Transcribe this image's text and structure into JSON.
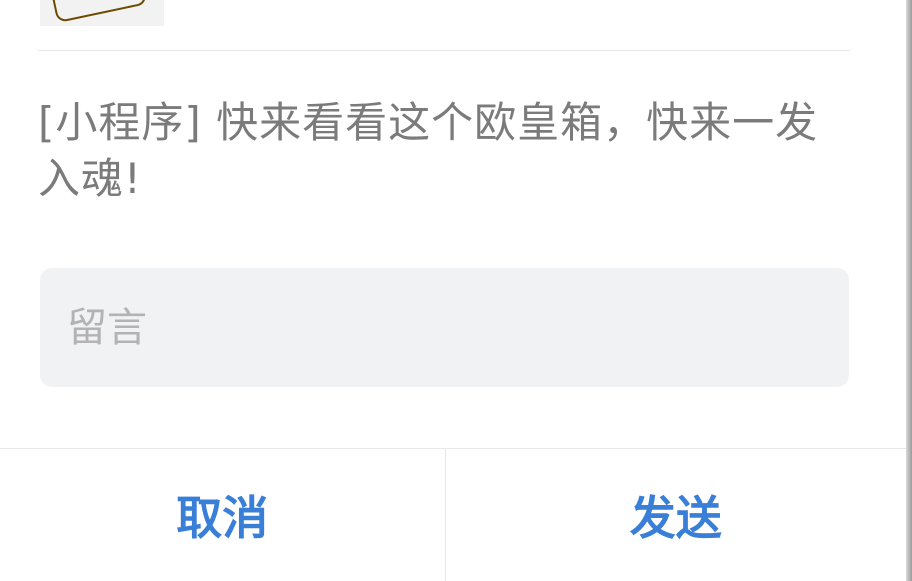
{
  "share": {
    "title": "[小程序] 快来看看这个欧皇箱，快来一发入魂!"
  },
  "message": {
    "placeholder": "留言",
    "value": ""
  },
  "actions": {
    "cancel": "取消",
    "send": "发送"
  },
  "colors": {
    "accent": "#3a7fd7",
    "text_muted": "#7b7b7b",
    "input_bg": "#f1f2f4"
  }
}
